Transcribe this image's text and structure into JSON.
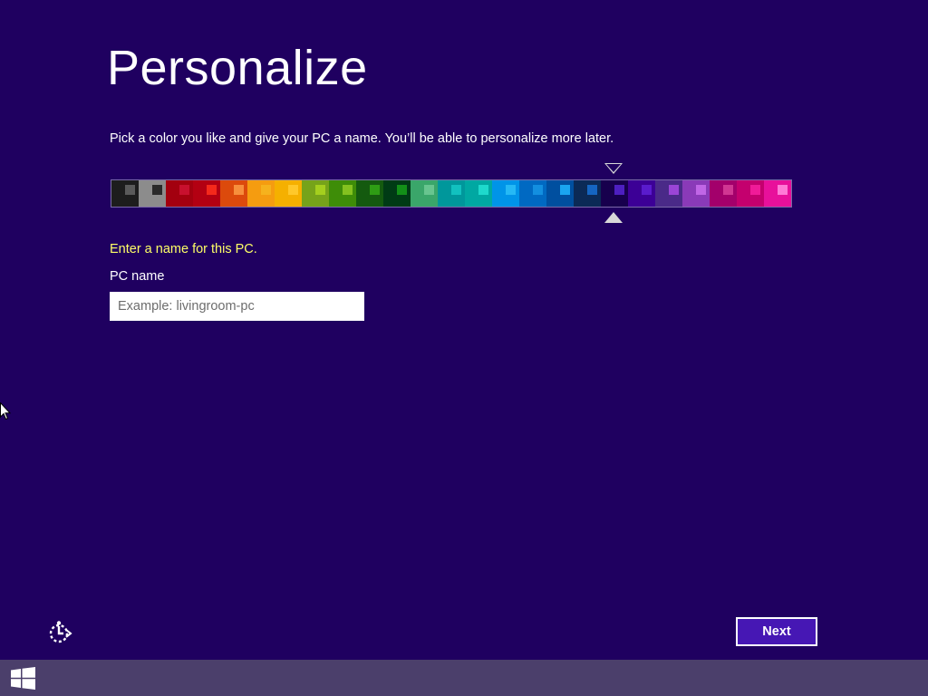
{
  "page": {
    "title": "Personalize",
    "subtitle": "Pick a color you like and give your PC a name. You’ll be able to personalize more later."
  },
  "colors": {
    "background": "#1f0060",
    "prompt": "#ffff66",
    "next_button": "#4617b4",
    "taskbar": "#4b3f6b",
    "selected_index": 18,
    "swatches": [
      {
        "bg": "#1d1d1d",
        "chip": "#5a5a5a",
        "chip_side": "right"
      },
      {
        "bg": "#8c8c8c",
        "chip": "#2a2a2a",
        "chip_side": "right"
      },
      {
        "bg": "#a3000f",
        "chip": "#c8102e",
        "chip_side": "right"
      },
      {
        "bg": "#b30012",
        "chip": "#f4291b",
        "chip_side": "right"
      },
      {
        "bg": "#dc4a0c",
        "chip": "#f78f3c",
        "chip_side": "right"
      },
      {
        "bg": "#f59c10",
        "chip": "#f6b21d",
        "chip_side": "right"
      },
      {
        "bg": "#f5b000",
        "chip": "#ffc82a",
        "chip_side": "right"
      },
      {
        "bg": "#76a31a",
        "chip": "#a4cf1e",
        "chip_side": "right"
      },
      {
        "bg": "#3e8d08",
        "chip": "#84c21f",
        "chip_side": "right"
      },
      {
        "bg": "#145a0f",
        "chip": "#2e9d14",
        "chip_side": "right"
      },
      {
        "bg": "#003b15",
        "chip": "#138f18",
        "chip_side": "right"
      },
      {
        "bg": "#3aa66a",
        "chip": "#68c58f",
        "chip_side": "right"
      },
      {
        "bg": "#00979b",
        "chip": "#12c1bf",
        "chip_side": "right"
      },
      {
        "bg": "#00a8a2",
        "chip": "#1ed9cc",
        "chip_side": "right"
      },
      {
        "bg": "#0094e8",
        "chip": "#25b9f5",
        "chip_side": "right"
      },
      {
        "bg": "#0069c2",
        "chip": "#138fe0",
        "chip_side": "right"
      },
      {
        "bg": "#004f9f",
        "chip": "#1aa5f0",
        "chip_side": "right"
      },
      {
        "bg": "#0b2a56",
        "chip": "#1565c0",
        "chip_side": "right"
      },
      {
        "bg": "#17004d",
        "chip": "#4d1fc0",
        "chip_side": "right"
      },
      {
        "bg": "#3c0096",
        "chip": "#5a1bcc",
        "chip_side": "right"
      },
      {
        "bg": "#4a2a88",
        "chip": "#9a45d6",
        "chip_side": "right"
      },
      {
        "bg": "#8a3ab8",
        "chip": "#c066e6",
        "chip_side": "right"
      },
      {
        "bg": "#a3006b",
        "chip": "#d13692",
        "chip_side": "right"
      },
      {
        "bg": "#c4006e",
        "chip": "#f01b98",
        "chip_side": "right"
      },
      {
        "bg": "#e8109b",
        "chip": "#ff7ad6",
        "chip_side": "right"
      }
    ]
  },
  "form": {
    "prompt": "Enter a name for this PC.",
    "label": "PC name",
    "value": "",
    "placeholder": "Example: livingroom-pc"
  },
  "actions": {
    "next_label": "Next"
  },
  "icons": {
    "ease_of_access": "ease-of-access-icon",
    "start": "windows-start-icon",
    "cursor": "mouse-pointer-icon"
  }
}
